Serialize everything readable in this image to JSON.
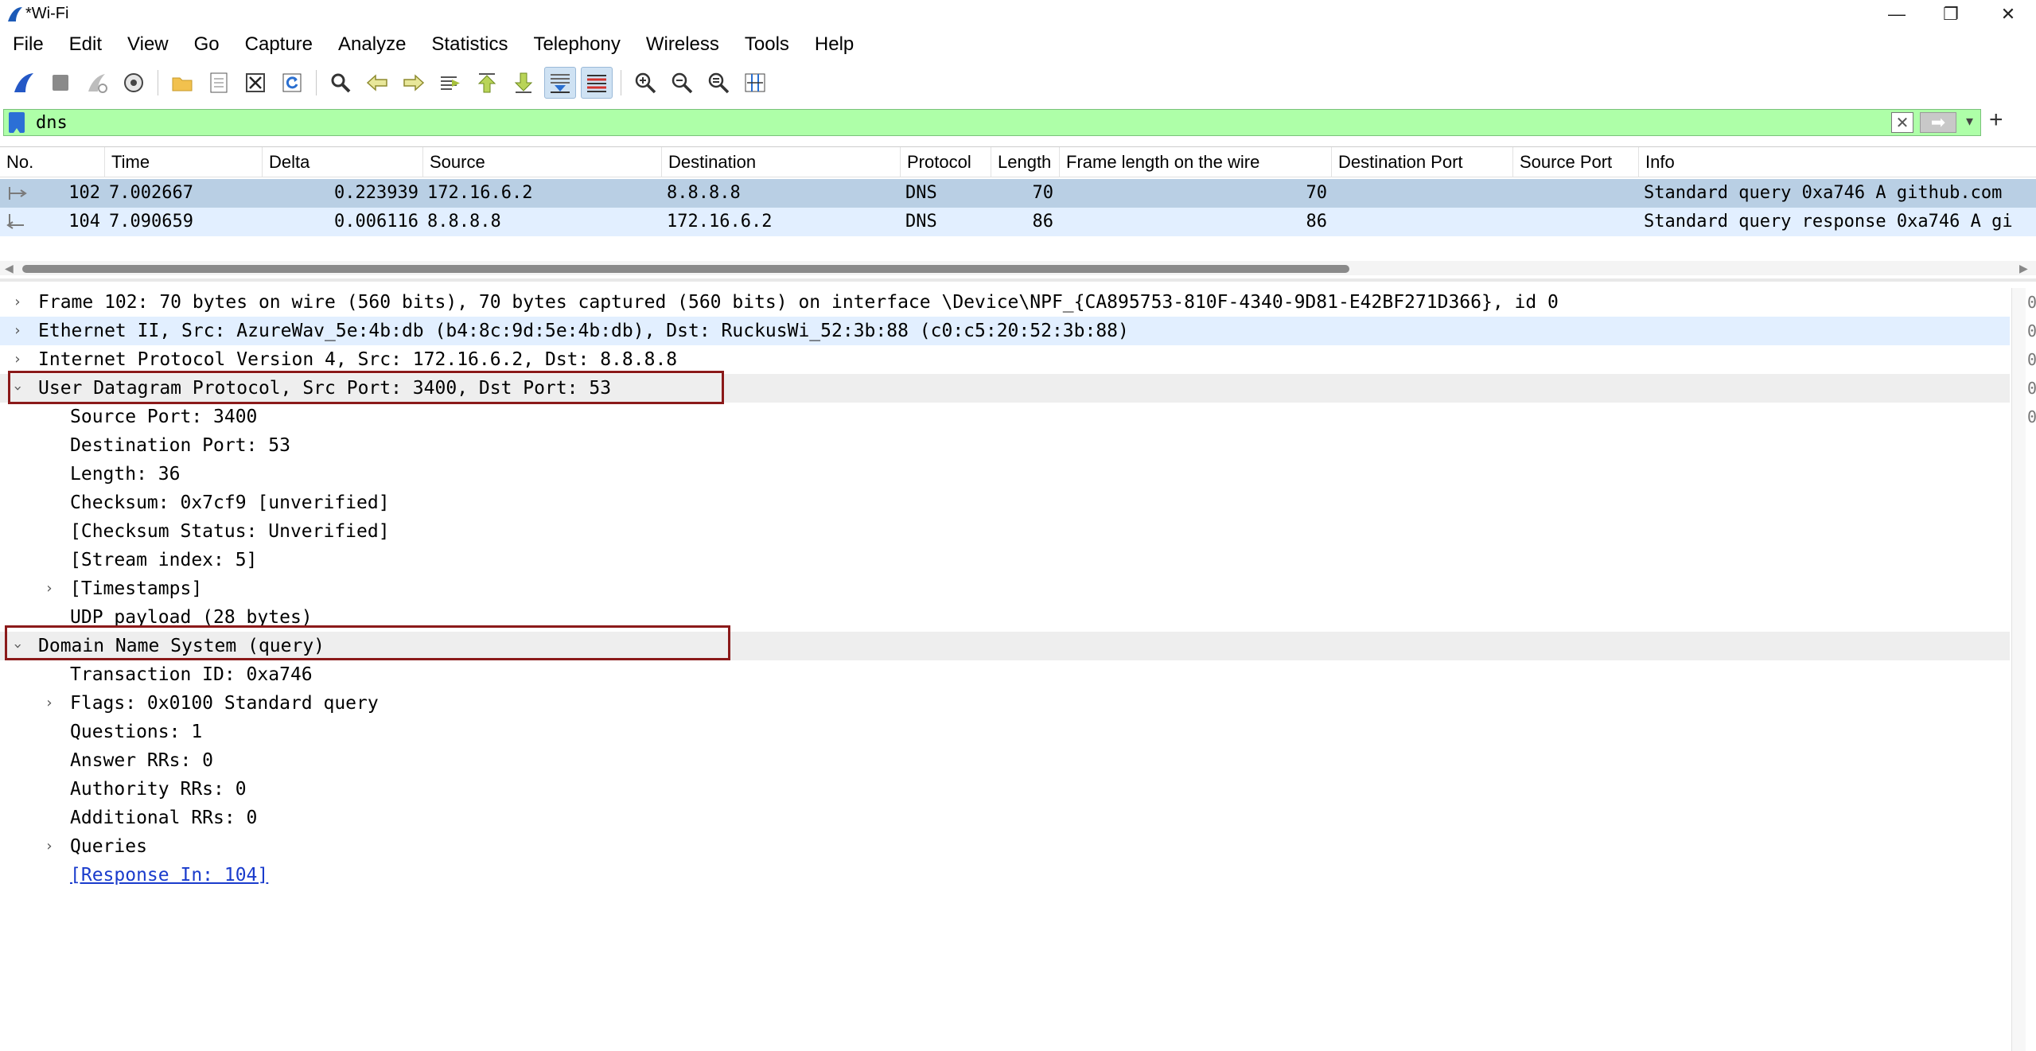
{
  "window": {
    "title": "*Wi-Fi",
    "minimize": "—",
    "restore": "❐",
    "close": "✕"
  },
  "menu": [
    "File",
    "Edit",
    "View",
    "Go",
    "Capture",
    "Analyze",
    "Statistics",
    "Telephony",
    "Wireless",
    "Tools",
    "Help"
  ],
  "menu_mnemonics": [
    "F",
    "E",
    "V",
    "G",
    "C",
    "A",
    "S",
    "",
    "W",
    "T",
    "H"
  ],
  "toolbar": {
    "icons": [
      "shark-fin-start-icon",
      "stop-capture-icon",
      "restart-capture-icon",
      "capture-options-icon",
      "open-file-icon",
      "save-file-icon",
      "close-file-icon",
      "reload-file-icon",
      "find-packet-icon",
      "go-back-icon",
      "go-forward-icon",
      "go-to-packet-icon",
      "go-first-packet-icon",
      "go-last-packet-icon",
      "auto-scroll-icon",
      "colorize-icon",
      "zoom-in-icon",
      "zoom-out-icon",
      "normal-size-icon",
      "resize-columns-icon"
    ]
  },
  "filter": {
    "value": "dns",
    "clear_glyph": "✕",
    "apply_glyph": "➡",
    "dropdown_glyph": "▾",
    "add_glyph": "+"
  },
  "packet_list": {
    "columns": [
      "No.",
      "Time",
      "Delta",
      "Source",
      "Destination",
      "Protocol",
      "Length",
      "Frame length on the wire",
      "Destination Port",
      "Source Port",
      "Info"
    ],
    "rows": [
      {
        "no": "102",
        "time": "7.002667",
        "delta": "0.223939",
        "source": "172.16.6.2",
        "destination": "8.8.8.8",
        "protocol": "DNS",
        "length": "70",
        "frame_len": "70",
        "dst_port": "",
        "src_port": "",
        "info": "Standard query 0xa746 A github.com"
      },
      {
        "no": "104",
        "time": "7.090659",
        "delta": "0.006116",
        "source": "8.8.8.8",
        "destination": "172.16.6.2",
        "protocol": "DNS",
        "length": "86",
        "frame_len": "86",
        "dst_port": "",
        "src_port": "",
        "info": "Standard query response 0xa746 A gi"
      }
    ]
  },
  "details": {
    "frame": "Frame 102: 70 bytes on wire (560 bits), 70 bytes captured (560 bits) on interface \\Device\\NPF_{CA895753-810F-4340-9D81-E42BF271D366}, id 0",
    "ethernet": "Ethernet II, Src: AzureWav_5e:4b:db (b4:8c:9d:5e:4b:db), Dst: RuckusWi_52:3b:88 (c0:c5:20:52:3b:88)",
    "ip": "Internet Protocol Version 4, Src: 172.16.6.2, Dst: 8.8.8.8",
    "udp": "User Datagram Protocol, Src Port: 3400, Dst Port: 53",
    "udp_fields": {
      "src_port": "Source Port: 3400",
      "dst_port": "Destination Port: 53",
      "length": "Length: 36",
      "checksum": "Checksum: 0x7cf9 [unverified]",
      "checksum_status": "[Checksum Status: Unverified]",
      "stream_index": "[Stream index: 5]",
      "timestamps": "[Timestamps]",
      "payload": "UDP payload (28 bytes)"
    },
    "dns": "Domain Name System (query)",
    "dns_fields": {
      "transaction_id": "Transaction ID: 0xa746",
      "flags": "Flags: 0x0100 Standard query",
      "questions": "Questions: 1",
      "answer_rrs": "Answer RRs: 0",
      "authority_rrs": "Authority RRs: 0",
      "additional_rrs": "Additional RRs: 0",
      "queries": "Queries",
      "response_in": "[Response In: 104]"
    }
  },
  "colors": {
    "filter_ok": "#aeffa8",
    "selected_row": "#b9cfe4",
    "related_row": "#e2efff",
    "highlight_box": "#8b1a1a",
    "link": "#1a3ccc"
  }
}
